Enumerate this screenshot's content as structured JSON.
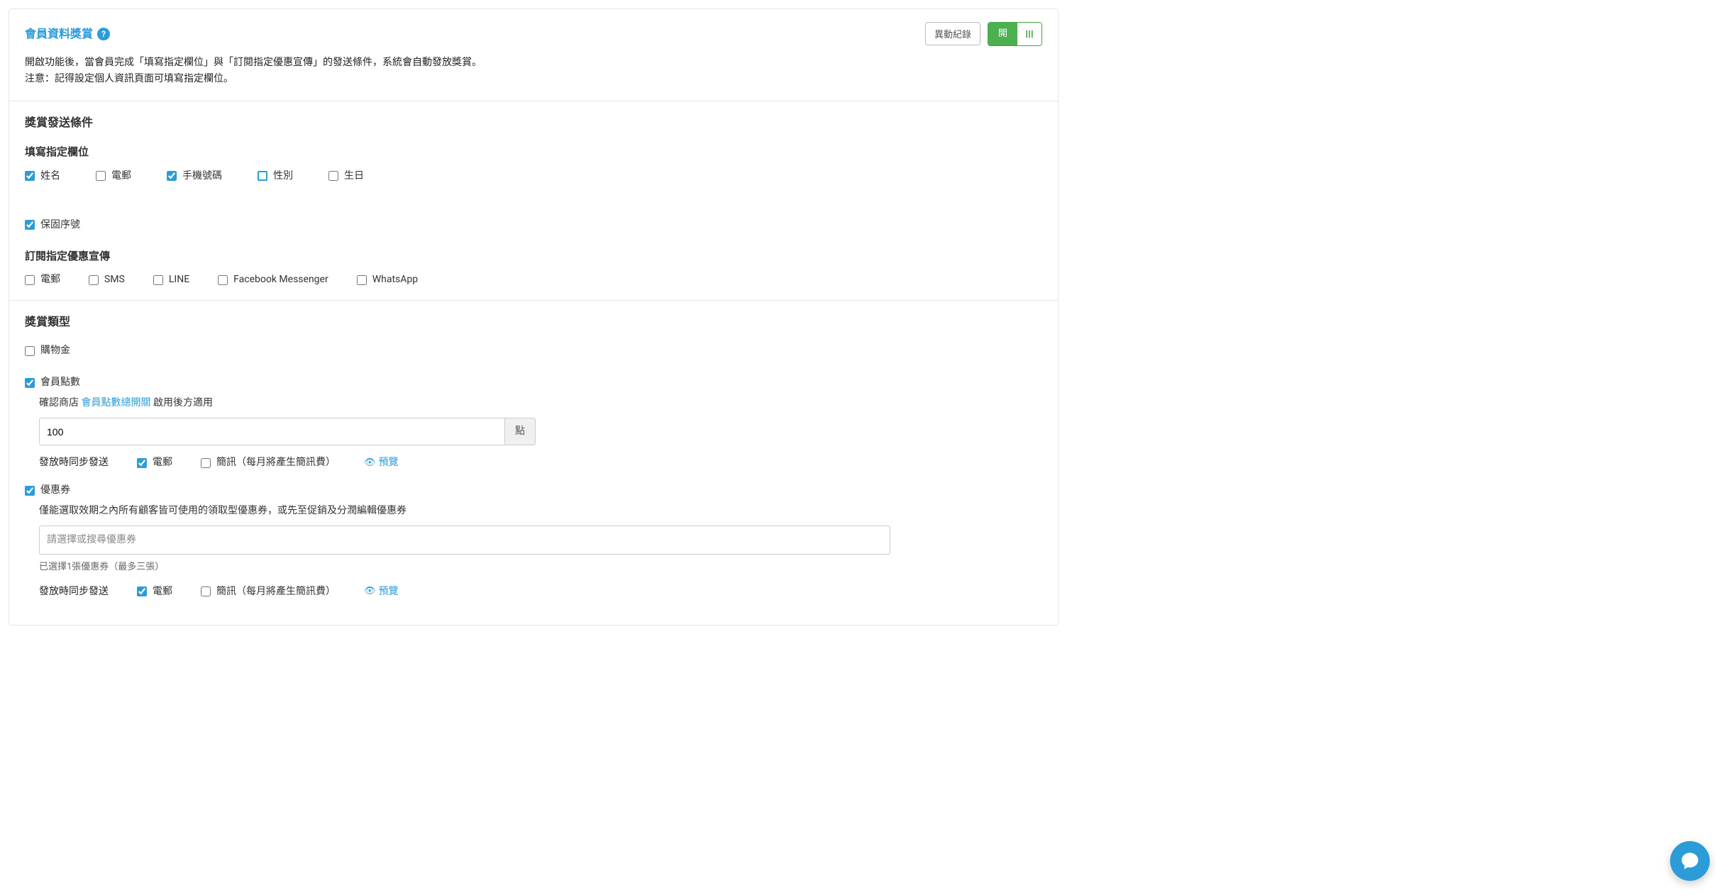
{
  "header": {
    "title": "會員資料獎賞",
    "help_glyph": "?",
    "change_log_btn": "異動紀錄",
    "toggle_on_label": "開",
    "desc_line1": "開啟功能後，當會員完成「填寫指定欄位」與「訂閱指定優惠宣傳」的發送條件，系統會自動發放獎賞。",
    "desc_line2": "注意：記得設定個人資訊頁面可填寫指定欄位。"
  },
  "conditions": {
    "heading": "獎賞發送條件",
    "fill_fields_heading": "填寫指定欄位",
    "fill_fields": [
      {
        "label": "姓名",
        "checked": true
      },
      {
        "label": "電郵",
        "checked": false
      },
      {
        "label": "手機號碼",
        "checked": true
      },
      {
        "label": "性別",
        "checked": false,
        "outlined": true
      },
      {
        "label": "生日",
        "checked": false
      },
      {
        "label": "保固序號",
        "checked": true
      }
    ],
    "subscribe_heading": "訂閱指定優惠宣傳",
    "subscribe": [
      {
        "label": "電郵",
        "checked": false
      },
      {
        "label": "SMS",
        "checked": false
      },
      {
        "label": "LINE",
        "checked": false
      },
      {
        "label": "Facebook Messenger",
        "checked": false
      },
      {
        "label": "WhatsApp",
        "checked": false
      }
    ]
  },
  "rewards": {
    "heading": "獎賞類型",
    "credit": {
      "label": "購物金",
      "checked": false
    },
    "points": {
      "label": "會員點數",
      "checked": true,
      "hint_before": "確認商店 ",
      "hint_link": "會員點數總開關",
      "hint_after": " 啟用後方適用",
      "value": "100",
      "unit": "點",
      "sync_label": "發放時同步發送",
      "sync_email": {
        "label": "電郵",
        "checked": true
      },
      "sync_sms": {
        "label": "簡訊（每月將產生簡訊費）",
        "checked": false
      },
      "preview": "預覽"
    },
    "coupon": {
      "label": "優惠券",
      "checked": true,
      "hint": "僅能選取效期之內所有顧客皆可使用的領取型優惠券，或先至促銷及分潤編輯優惠券",
      "select_placeholder": "請選擇或搜尋優惠券",
      "selected_text": "已選擇1張優惠券（最多三張）",
      "sync_label": "發放時同步發送",
      "sync_email": {
        "label": "電郵",
        "checked": true
      },
      "sync_sms": {
        "label": "簡訊（每月將產生簡訊費）",
        "checked": false
      },
      "preview": "預覽"
    }
  }
}
